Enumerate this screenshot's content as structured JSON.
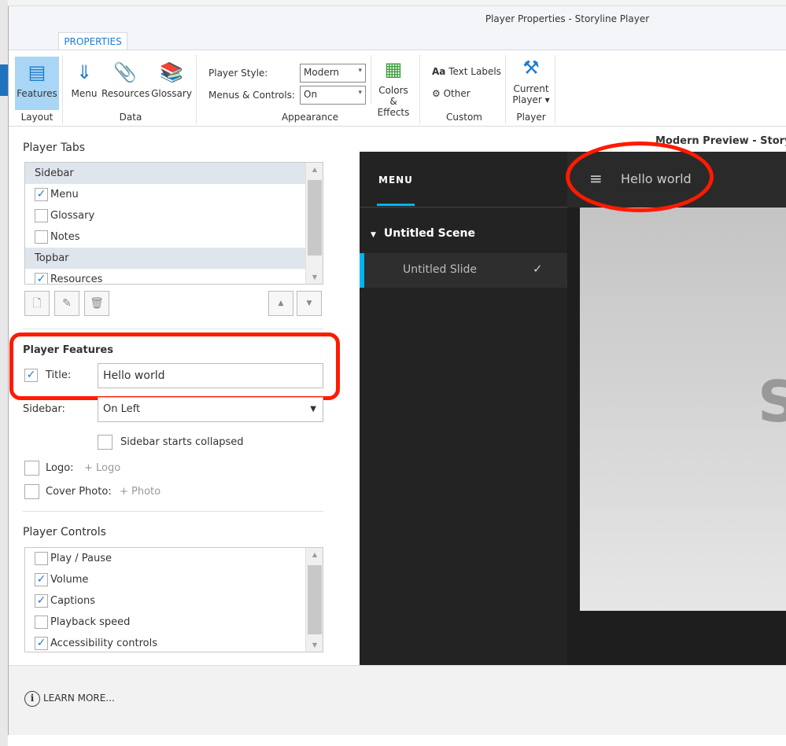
{
  "window": {
    "title": "Player Properties - Storyline Player"
  },
  "tab": "PROPERTIES",
  "ribbon": {
    "features": "Features",
    "menu": "Menu",
    "resources": "Resources",
    "glossary": "Glossary",
    "player_style_label": "Player Style:",
    "player_style_value": "Modern",
    "menus_controls_label": "Menus & Controls:",
    "menus_controls_value": "On",
    "colors_effects": "Colors & Effects",
    "text_labels": "Text Labels",
    "other": "Other",
    "current_player": "Current Player",
    "groups": {
      "layout": "Layout",
      "data": "Data",
      "appearance": "Appearance",
      "custom": "Custom",
      "player": "Player"
    }
  },
  "player_tabs": {
    "title": "Player Tabs",
    "items": [
      {
        "label": "Sidebar",
        "type": "header"
      },
      {
        "label": "Menu",
        "checked": true
      },
      {
        "label": "Glossary",
        "checked": false
      },
      {
        "label": "Notes",
        "checked": false
      },
      {
        "label": "Topbar",
        "type": "header"
      },
      {
        "label": "Resources",
        "checked": true
      }
    ]
  },
  "player_features": {
    "title": "Player Features",
    "title_label": "Title:",
    "title_checked": true,
    "title_value": "Hello world",
    "sidebar_label": "Sidebar:",
    "sidebar_value": "On Left",
    "sidebar_collapsed": "Sidebar starts collapsed",
    "logo_label": "Logo:",
    "logo_add": "+ Logo",
    "cover_label": "Cover Photo:",
    "cover_add": "+ Photo"
  },
  "player_controls": {
    "title": "Player Controls",
    "items": [
      {
        "label": "Play / Pause",
        "checked": false
      },
      {
        "label": "Volume",
        "checked": true
      },
      {
        "label": "Captions",
        "checked": true
      },
      {
        "label": "Playback speed",
        "checked": false
      },
      {
        "label": "Accessibility controls",
        "checked": true
      }
    ]
  },
  "preview": {
    "title": "Modern Preview - Storyline",
    "menu_tab": "MENU",
    "scene": "Untitled Scene",
    "slide": "Untitled Slide",
    "player_title": "Hello world",
    "slide_letter": "S"
  },
  "footer": {
    "learn_more": "LEARN MORE..."
  },
  "colors": {
    "accent": "#1e7bd3",
    "highlight": "#ff1a00",
    "preview_accent": "#00b4f0"
  }
}
